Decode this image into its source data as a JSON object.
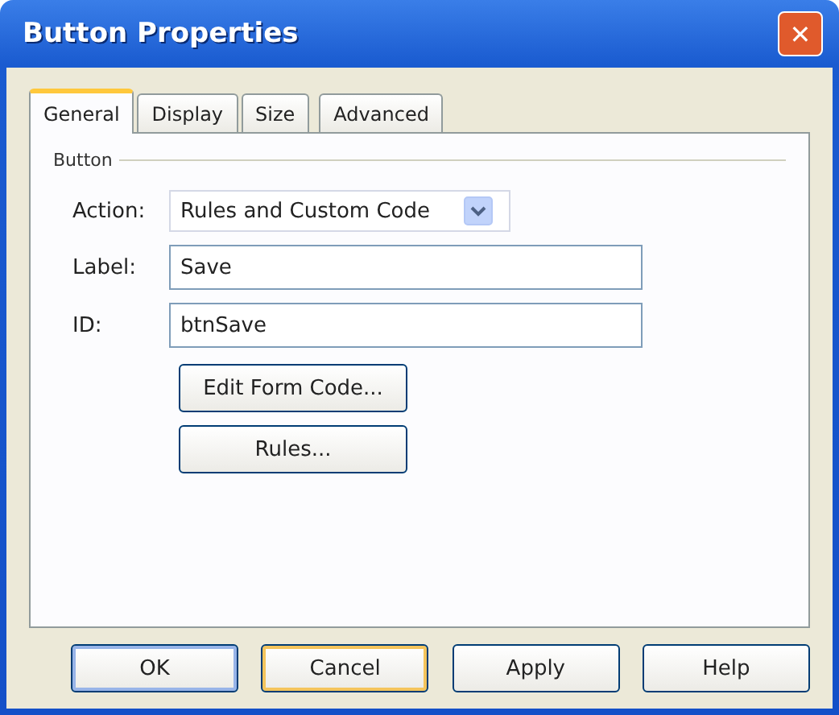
{
  "window": {
    "title": "Button Properties",
    "close": "✕"
  },
  "tabs": [
    {
      "label": "General",
      "selected": true
    },
    {
      "label": "Display",
      "selected": false
    },
    {
      "label": "Size",
      "selected": false
    },
    {
      "label": "Advanced",
      "selected": false
    }
  ],
  "group": {
    "title": "Button",
    "fields": [
      {
        "kind": "dropdown",
        "label": "Action:",
        "value": "Rules and Custom Code"
      },
      {
        "kind": "text",
        "label": "Label:",
        "value": "Save"
      },
      {
        "kind": "text",
        "label": "ID:",
        "value": "btnSave"
      }
    ],
    "buttons": [
      "Edit Form Code...",
      "Rules..."
    ]
  },
  "footer_buttons": [
    "OK",
    "Cancel",
    "Apply",
    "Help"
  ]
}
